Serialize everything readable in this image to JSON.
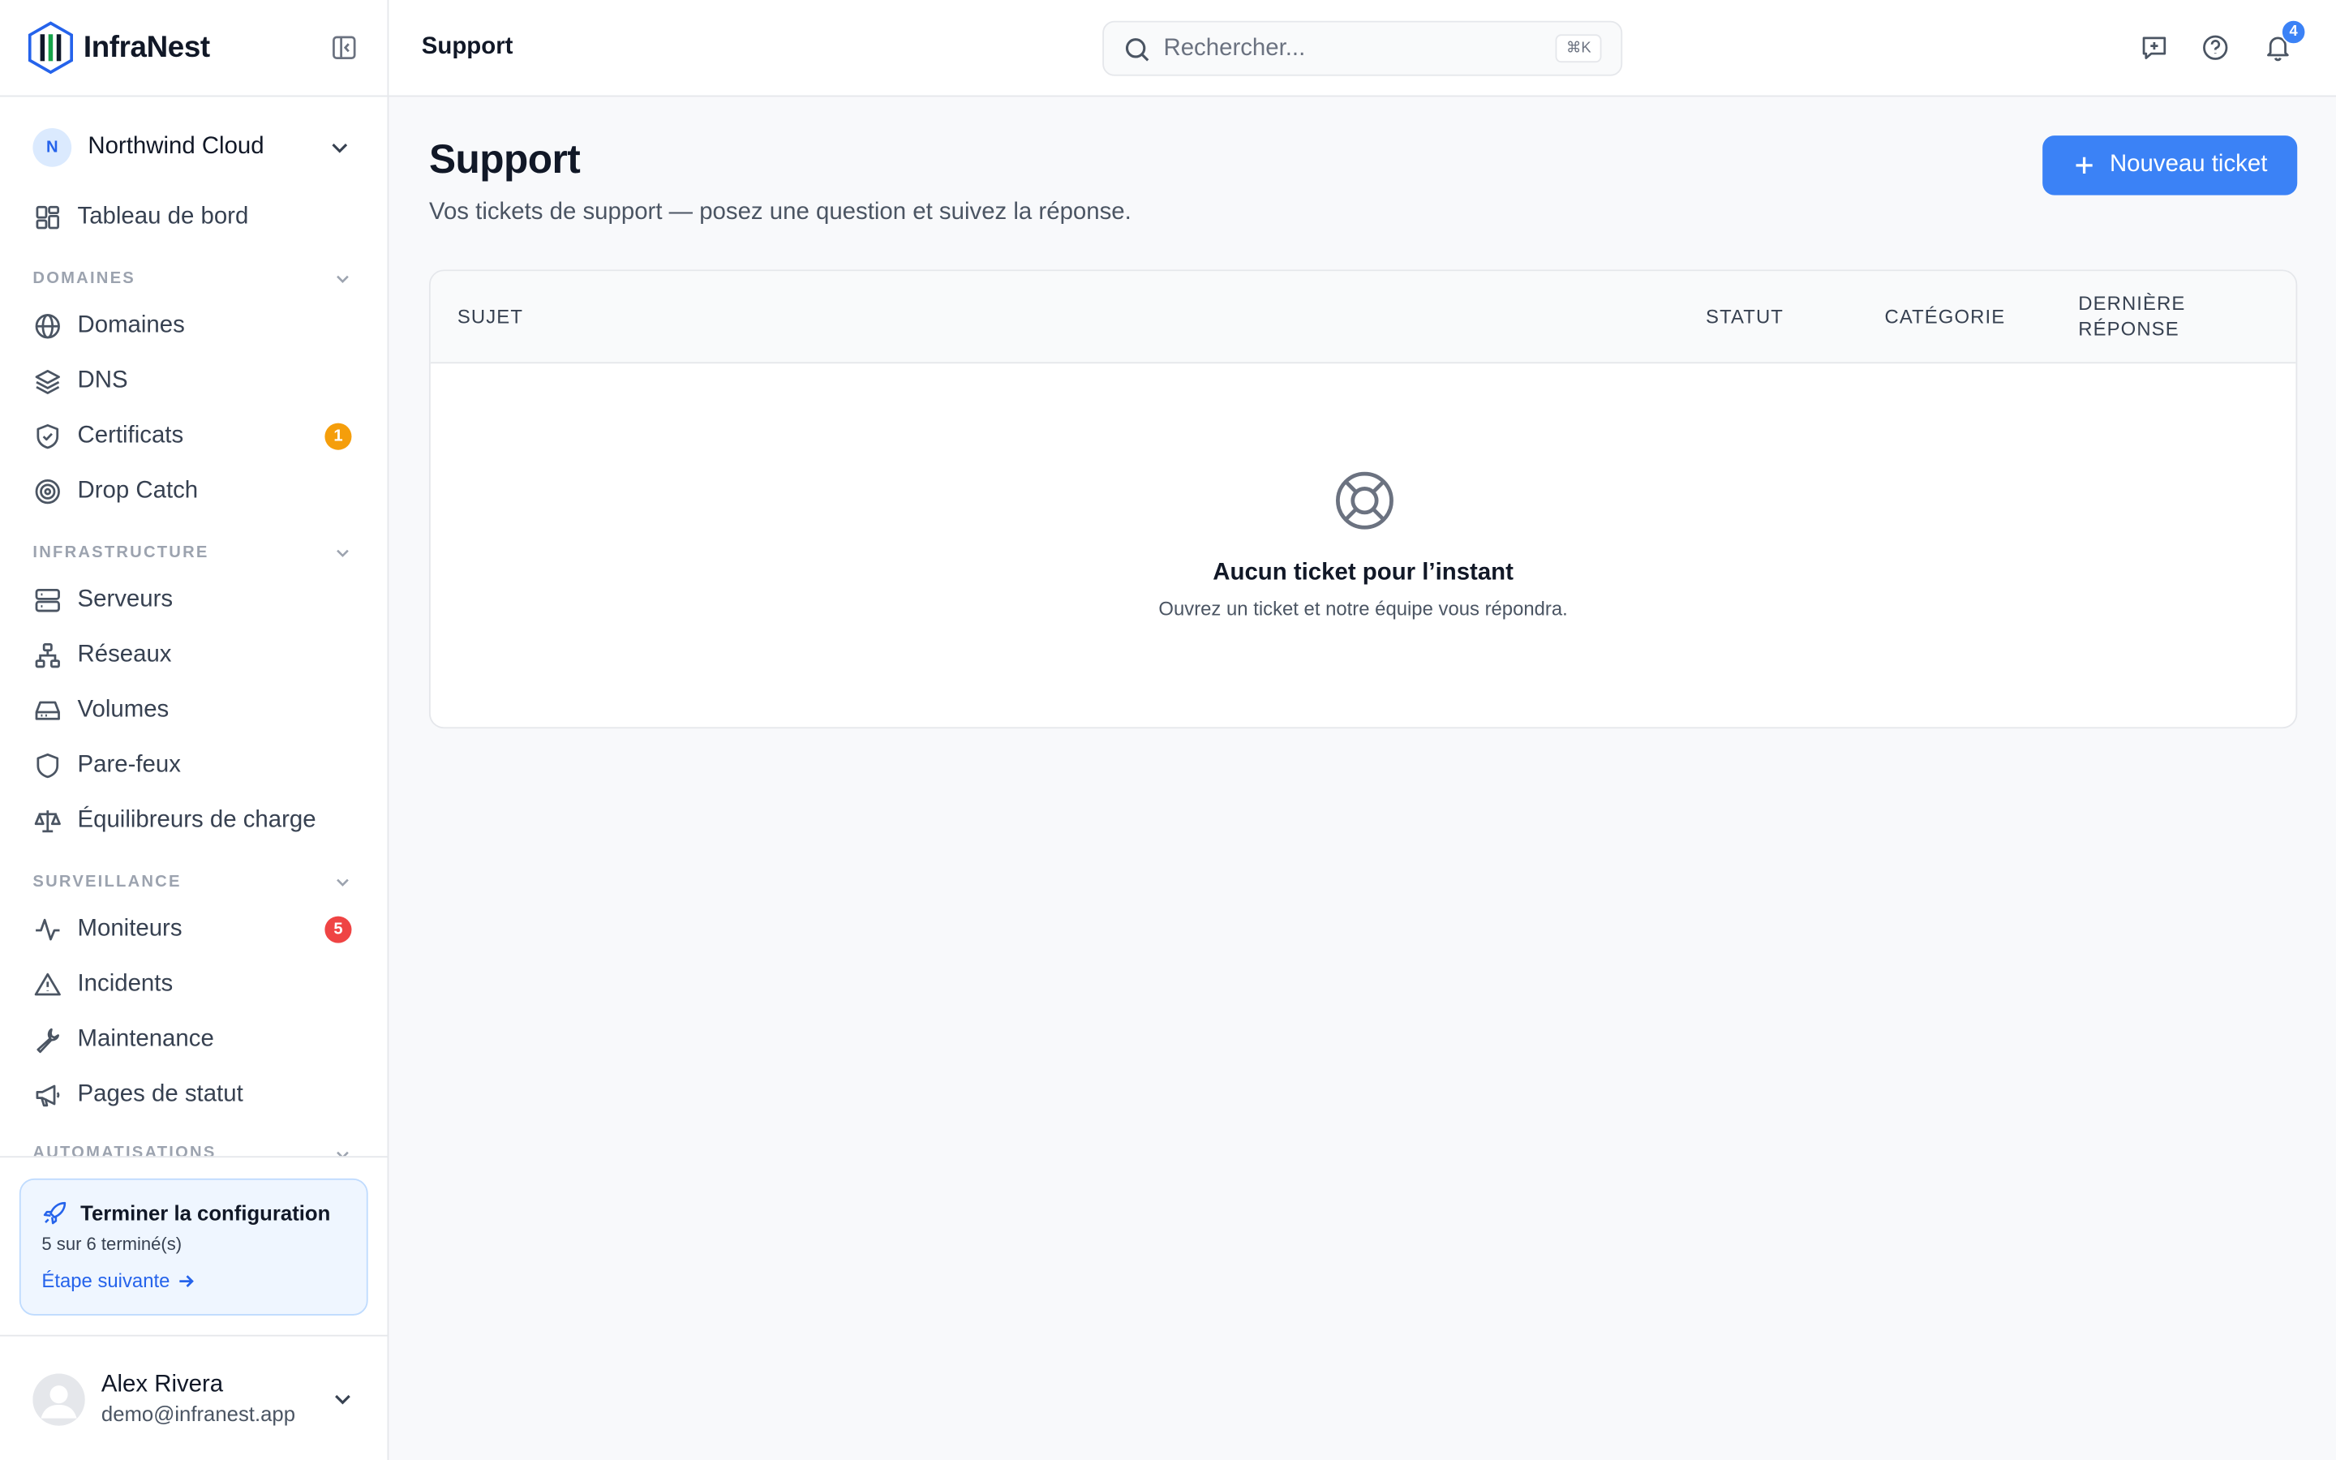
{
  "app": {
    "name": "InfraNest"
  },
  "org": {
    "initial": "N",
    "name": "Northwind Cloud"
  },
  "sidebar": {
    "dashboard": "Tableau de bord",
    "sections": {
      "domains": {
        "title": "DOMAINES",
        "items": [
          "Domaines",
          "DNS",
          "Certificats",
          "Drop Catch"
        ]
      },
      "infra": {
        "title": "INFRASTRUCTURE",
        "items": [
          "Serveurs",
          "Réseaux",
          "Volumes",
          "Pare-feux",
          "Équilibreurs de charge"
        ]
      },
      "monitoring": {
        "title": "SURVEILLANCE",
        "items": [
          "Moniteurs",
          "Incidents",
          "Maintenance",
          "Pages de statut"
        ]
      },
      "automation": {
        "title": "AUTOMATISATIONS"
      }
    },
    "badges": {
      "certificates": "1",
      "certificates_color": "#f59e0b",
      "monitors": "5",
      "monitors_color": "#ef4444"
    }
  },
  "setup": {
    "title": "Terminer la configuration",
    "progress": "5 sur 6 terminé(s)",
    "link": "Étape suivante"
  },
  "user": {
    "name": "Alex Rivera",
    "email": "demo@infranest.app"
  },
  "header": {
    "title": "Support",
    "search_placeholder": "Rechercher...",
    "shortcut": "⌘K",
    "notifications_count": "4"
  },
  "page": {
    "title": "Support",
    "subtitle": "Vos tickets de support — posez une question et suivez la réponse.",
    "new_ticket": "Nouveau ticket"
  },
  "table": {
    "columns": {
      "subject": "SUJET",
      "status": "STATUT",
      "category": "CATÉGORIE",
      "last_reply_1": "DERNIÈRE",
      "last_reply_2": "RÉPONSE"
    },
    "empty_title": "Aucun ticket pour l’instant",
    "empty_subtitle": "Ouvrez un ticket et notre équipe vous répondra."
  },
  "colors": {
    "accent": "#3b82f6",
    "accent_light": "#eff6ff"
  }
}
